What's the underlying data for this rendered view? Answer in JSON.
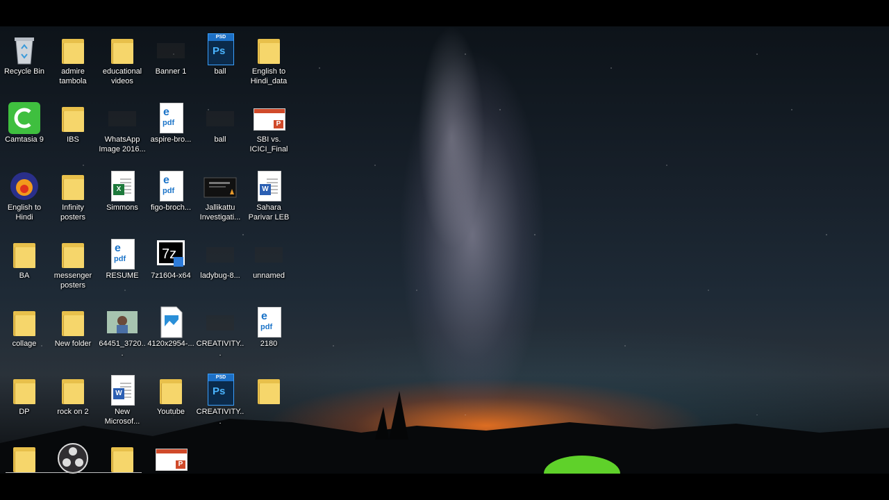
{
  "desktop": {
    "icons": [
      {
        "label": "Recycle Bin",
        "icon": "recycle-bin-icon"
      },
      {
        "label": "admire\ntambola",
        "icon": "folder-icon"
      },
      {
        "label": "educational\nvideos",
        "icon": "folder-icon"
      },
      {
        "label": "Banner 1",
        "icon": "image-icon"
      },
      {
        "label": "ball",
        "icon": "psd-icon"
      },
      {
        "label": "English to\nHindi_data",
        "icon": "folder-icon"
      },
      {
        "label": "Camtasia 9",
        "icon": "camtasia-icon"
      },
      {
        "label": "IBS",
        "icon": "folder-icon"
      },
      {
        "label": "WhatsApp\nImage 2016...",
        "icon": "image-icon"
      },
      {
        "label": "aspire-bro...",
        "icon": "pdf-icon"
      },
      {
        "label": "ball",
        "icon": "image-icon"
      },
      {
        "label": "SBI vs.\nICICI_Final",
        "icon": "powerpoint-icon"
      },
      {
        "label": "English to\nHindi",
        "icon": "app-icon"
      },
      {
        "label": "Infinity\nposters",
        "icon": "folder-icon"
      },
      {
        "label": "Simmons",
        "icon": "excel-icon"
      },
      {
        "label": "figo-broch...",
        "icon": "pdf-icon"
      },
      {
        "label": "Jallikattu\nInvestigati...",
        "icon": "video-icon"
      },
      {
        "label": "Sahara\nParivar LEB",
        "icon": "word-icon"
      },
      {
        "label": "BA",
        "icon": "folder-icon"
      },
      {
        "label": "messenger\nposters",
        "icon": "folder-icon"
      },
      {
        "label": "RESUME",
        "icon": "pdf-icon"
      },
      {
        "label": "7z1604-x64",
        "icon": "7zip-installer-icon"
      },
      {
        "label": "ladybug-8...",
        "icon": "image-icon"
      },
      {
        "label": "unnamed",
        "icon": "image-icon"
      },
      {
        "label": "collage",
        "icon": "folder-icon"
      },
      {
        "label": "New folder",
        "icon": "folder-icon"
      },
      {
        "label": "64451_3720...",
        "icon": "photo-icon"
      },
      {
        "label": "4120x2954-...",
        "icon": "image-file-icon"
      },
      {
        "label": "CREATIVITY...",
        "icon": "image-icon"
      },
      {
        "label": "2180",
        "icon": "pdf-icon"
      },
      {
        "label": "DP",
        "icon": "folder-icon"
      },
      {
        "label": "rock on 2",
        "icon": "folder-icon"
      },
      {
        "label": "New\nMicrosof...",
        "icon": "word-icon"
      },
      {
        "label": "Youtube",
        "icon": "folder-icon"
      },
      {
        "label": "CREATIVITY...",
        "icon": "psd-icon"
      },
      {
        "label": "",
        "icon": "folder-icon"
      },
      {
        "label": "",
        "icon": "folder-icon"
      },
      {
        "label": "",
        "icon": "obs-icon"
      },
      {
        "label": "",
        "icon": "folder-icon"
      },
      {
        "label": "",
        "icon": "powerpoint-icon"
      }
    ]
  },
  "colors": {
    "folder": "#f6d66b",
    "pdf_accent": "#1a73c8",
    "ps_accent": "#4ab4ff",
    "camtasia": "#3fbf3f"
  }
}
